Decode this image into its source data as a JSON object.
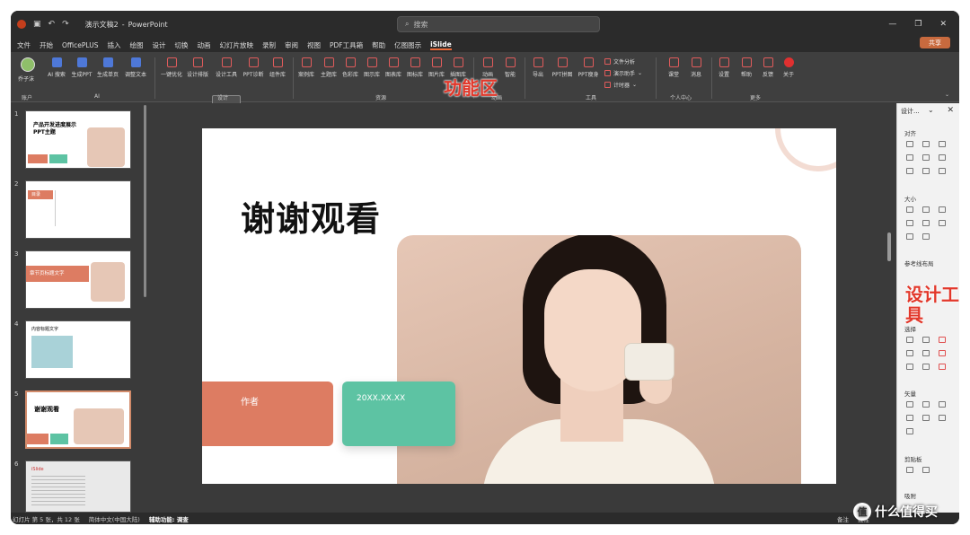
{
  "titlebar": {
    "app_icon": "powerpoint-icon",
    "doc_title": "演示文稿2",
    "app_name": "PowerPoint",
    "search_placeholder": "搜索"
  },
  "menu": [
    "文件",
    "开始",
    "OfficePLUS",
    "插入",
    "绘图",
    "设计",
    "切换",
    "动画",
    "幻灯片放映",
    "录制",
    "审阅",
    "视图",
    "PDF工具箱",
    "帮助",
    "亿图图示",
    "iSlide"
  ],
  "share_label": "共享",
  "ribbon": {
    "account": "乔子沫",
    "ai_buttons": [
      "AI 搜索",
      "生成PPT",
      "生成单页",
      "调整文本"
    ],
    "design_buttons": [
      "一键优化",
      "设计排版",
      "设计工具",
      "PPT诊断",
      "组件库"
    ],
    "resource_buttons": [
      "案例库",
      "主题库",
      "色彩库",
      "图示库",
      "图表库",
      "图标库",
      "图片库",
      "插图库"
    ],
    "animation_buttons": [
      "动画",
      "智能"
    ],
    "tool_buttons": [
      "导出",
      "PPT拼图",
      "PPT瘦身"
    ],
    "tool_small": [
      "文件分析",
      "演示助手",
      "计时器"
    ],
    "personal_buttons": [
      "课堂",
      "消息"
    ],
    "more_buttons": [
      "设置",
      "帮助",
      "反馈",
      "关于"
    ],
    "groups": [
      "账户",
      "AI",
      "设计",
      "资源",
      "动画",
      "工具",
      "个人中心",
      "更多"
    ]
  },
  "annotations": {
    "ribbon": "功能区",
    "panel": "设计工具"
  },
  "thumbnails": [
    {
      "num": "1",
      "title": "产品开发进度展示PPT主题"
    },
    {
      "num": "2",
      "title": "目录"
    },
    {
      "num": "3",
      "title": "章节页标题文字"
    },
    {
      "num": "4",
      "title": "内容标题文字"
    },
    {
      "num": "5",
      "title": "谢谢观看"
    },
    {
      "num": "6",
      "title": "iSlide"
    }
  ],
  "slide": {
    "title": "谢谢观看",
    "author_label": "作者",
    "date_label": "20XX.XX.XX"
  },
  "panel": {
    "title": "设计...",
    "sections": [
      "对齐",
      "大小",
      "参考线布局",
      "选择",
      "矢量",
      "剪贴板",
      "吸附"
    ]
  },
  "status": {
    "slide_info": "幻灯片 第 5 张，共 12 张",
    "language": "简体中文(中国大陆)",
    "accessibility": "辅助功能: 调查",
    "notes": "备注",
    "comments": "批注"
  },
  "watermark": "什么值得买",
  "colors": {
    "accent_orange": "#dd7c62",
    "accent_green": "#5dc3a3",
    "annotation_red": "#e2372a"
  }
}
